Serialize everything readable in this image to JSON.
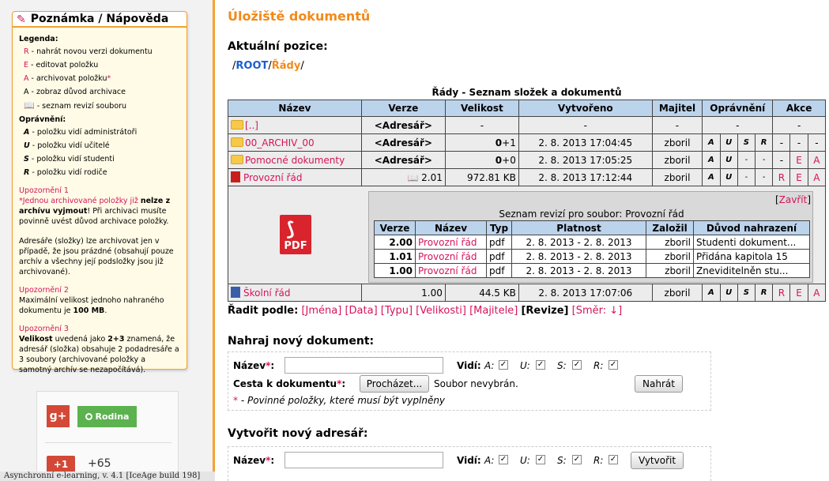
{
  "sidebar": {
    "note_title": "Poznámka / Nápověda",
    "legend_heading": "Legenda:",
    "legend": [
      {
        "key": "R",
        "text": "- nahrát novou verzi dokumentu"
      },
      {
        "key": "E",
        "text": "- editovat položku"
      },
      {
        "key": "A",
        "text": "- archivovat položku",
        "mark": "*"
      },
      {
        "key": "A",
        "text": "- zobraz důvod archivace"
      },
      {
        "key": "📖",
        "text": "- seznam revizí souboru"
      }
    ],
    "perm_heading": "Oprávnění:",
    "perms": [
      {
        "key": "A",
        "text": "- položku vidí administrátoři"
      },
      {
        "key": "U",
        "text": "- položku vidí učitelé"
      },
      {
        "key": "S",
        "text": "- položku vidí studenti"
      },
      {
        "key": "R",
        "text": "- položku vidí rodiče"
      }
    ],
    "warn1_title": "Upozornění 1",
    "warn1_a": "*Jednou archivované položky již ",
    "warn1_b": "nelze z archívu vyjmout",
    "warn1_c": "! Při archivaci musíte povinně uvést důvod archivace položky.",
    "warn1_p2": "Adresáře (složky) lze archivovat jen v případě, že jsou prázdné (obsahují pouze archív a všechny její podsložky jsou již archivované).",
    "warn2_title": "Upozornění 2",
    "warn2_a": "Maximální velikost jednoho nahraného dokumentu je ",
    "warn2_b": "100 MB",
    "warn2_c": ".",
    "warn3_title": "Upozornění 3",
    "warn3_a": "Velikost",
    "warn3_b": " uvedená jako ",
    "warn3_c": "2+3",
    "warn3_d": " znamená, že adresář (složka) obsahuje 2 podadresáře a 3 soubory (archivované položky a samotný archív se nezapočítává).",
    "gplus": "g+",
    "rodina": "Rodina",
    "plus1": "+1",
    "plus_count": "+65",
    "footer": "Asynchronní e-learning, v. 4.1 [IceAge build 198]"
  },
  "main": {
    "title": "Úložiště dokumentů",
    "position_label": "Aktuální pozice:",
    "crumb_sep": "/",
    "crumb_root": "ROOT",
    "crumb_current": "Řády",
    "table_caption": "Řády - Seznam složek a dokumentů",
    "columns": [
      "Název",
      "Verze",
      "Velikost",
      "Vytvořeno",
      "Majitel",
      "Oprávnění",
      "Akce"
    ],
    "rows": [
      {
        "name": "[..]",
        "version": "<Adresář>",
        "size": "-",
        "created": "-",
        "owner": "-",
        "perm": [
          "-",
          "-"
        ],
        "act": [
          "-"
        ]
      },
      {
        "name": "00_ARCHIV_00",
        "version": "<Adresář>",
        "size_b": "0",
        "size_n": "+1",
        "created": "2. 8. 2013 17:04:45",
        "owner": "zboril",
        "perm": [
          "A",
          "U",
          "S",
          "R"
        ],
        "act": [
          "-",
          "-",
          "-"
        ]
      },
      {
        "name": "Pomocné dokumenty",
        "version": "<Adresář>",
        "size_b": "0",
        "size_n": "+0",
        "created": "2. 8. 2013 17:05:25",
        "owner": "zboril",
        "perm": [
          "A",
          "U",
          "-",
          "-"
        ],
        "act": [
          "-",
          "E",
          "A"
        ]
      },
      {
        "name": "Provozní řád",
        "version": "2.01",
        "size": "972.81 KB",
        "created": "2. 8. 2013 17:12:44",
        "owner": "zboril",
        "perm": [
          "A",
          "U",
          "-",
          "-"
        ],
        "act": [
          "R",
          "E",
          "A"
        ]
      },
      {
        "name": "Školní řád",
        "version": "1.00",
        "size": "44.5 KB",
        "created": "2. 8. 2013 17:07:06",
        "owner": "zboril",
        "perm": [
          "A",
          "U",
          "S",
          "R"
        ],
        "act": [
          "R",
          "E",
          "A"
        ]
      }
    ],
    "pdf_label": "PDF",
    "revisions": {
      "close": "Zavřít",
      "title": "Seznam revizí pro soubor: Provozní řád",
      "columns": [
        "Verze",
        "Název",
        "Typ",
        "Platnost",
        "Založil",
        "Důvod nahrazení"
      ],
      "rows": [
        {
          "version": "2.00",
          "name": "Provozní řád",
          "type": "pdf",
          "validity": "2. 8. 2013 - 2. 8. 2013",
          "author": "zboril",
          "reason": "Studenti dokument..."
        },
        {
          "version": "1.01",
          "name": "Provozní řád",
          "type": "pdf",
          "validity": "2. 8. 2013 - 2. 8. 2013",
          "author": "zboril",
          "reason": "Přidána kapitola 15"
        },
        {
          "version": "1.00",
          "name": "Provozní řád",
          "type": "pdf",
          "validity": "2. 8. 2013 - 2. 8. 2013",
          "author": "zboril",
          "reason": "Zneviditelněn stu..."
        }
      ]
    },
    "sort": {
      "label": "Řadit podle:",
      "items": [
        "[Jména]",
        "[Data]",
        "[Typu]",
        "[Velikosti]",
        "[Majitele]",
        "[Revize]",
        "[Směr: ↓]"
      ]
    },
    "upload": {
      "heading": "Nahraj nový dokument:",
      "name_label": "Název",
      "name_value": "",
      "req": "*",
      "colon": ":",
      "vidi": "Vidí:",
      "perm_labels": [
        "A:",
        "U:",
        "S:",
        "R:"
      ],
      "perm_checked": [
        true,
        true,
        true,
        true
      ],
      "path_label": "Cesta k dokumentu",
      "browse": "Procházet...",
      "no_file": "Soubor nevybrán.",
      "submit": "Nahrát",
      "required_note": "- Povinné položky, které musí být vyplněny"
    },
    "newdir": {
      "heading": "Vytvořit nový adresář:",
      "name_label": "Název",
      "name_value": "",
      "vidi": "Vidí:",
      "perm_labels": [
        "A:",
        "U:",
        "S:",
        "R:"
      ],
      "perm_checked": [
        true,
        true,
        true,
        true
      ],
      "submit": "Vytvořit"
    }
  }
}
